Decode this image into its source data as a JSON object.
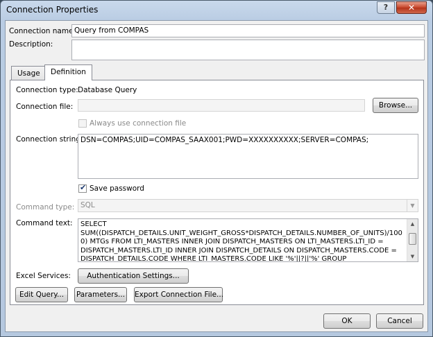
{
  "window": {
    "title": "Connection Properties",
    "help_label": "?",
    "close_label": "✕"
  },
  "fields": {
    "connection_name_label": "Connection name:",
    "connection_name_value": "Query from COMPAS",
    "description_label": "Description:",
    "description_value": ""
  },
  "tabs": [
    {
      "label": "Usage"
    },
    {
      "label": "Definition"
    }
  ],
  "definition": {
    "connection_type_label": "Connection type:",
    "connection_type_value": "Database Query",
    "connection_file_label": "Connection file:",
    "connection_file_value": "",
    "browse_label": "Browse...",
    "always_use_label": "Always use connection file",
    "connection_string_label": "Connection string:",
    "connection_string_value": "DSN=COMPAS;UID=COMPAS_SAAX001;PWD=XXXXXXXXXX;SERVER=COMPAS;",
    "save_password_label": "Save password",
    "save_password_checked": true,
    "command_type_label": "Command type:",
    "command_type_value": "SQL",
    "command_text_label": "Command text:",
    "command_text_value": "SELECT SUM((DISPATCH_DETAILS.UNIT_WEIGHT_GROSS*DISPATCH_DETAILS.NUMBER_OF_UNITS)/1000) MTGs FROM LTI_MASTERS INNER JOIN DISPATCH_MASTERS ON LTI_MASTERS.LTI_ID = DISPATCH_MASTERS.LTI_ID INNER JOIN DISPATCH_DETAILS ON DISPATCH_MASTERS.CODE = DISPATCH_DETAILS.CODE WHERE LTI_MASTERS.CODE LIKE '%'||?||'%' GROUP BYLTI_MASTERS.LTI_ID.",
    "excel_services_label": "Excel Services:",
    "auth_settings_label": "Authentication Settings..."
  },
  "bottom_buttons": {
    "edit_query": "Edit Query...",
    "parameters": "Parameters...",
    "export": "Export Connection File..."
  },
  "dialog_buttons": {
    "ok": "OK",
    "cancel": "Cancel"
  }
}
